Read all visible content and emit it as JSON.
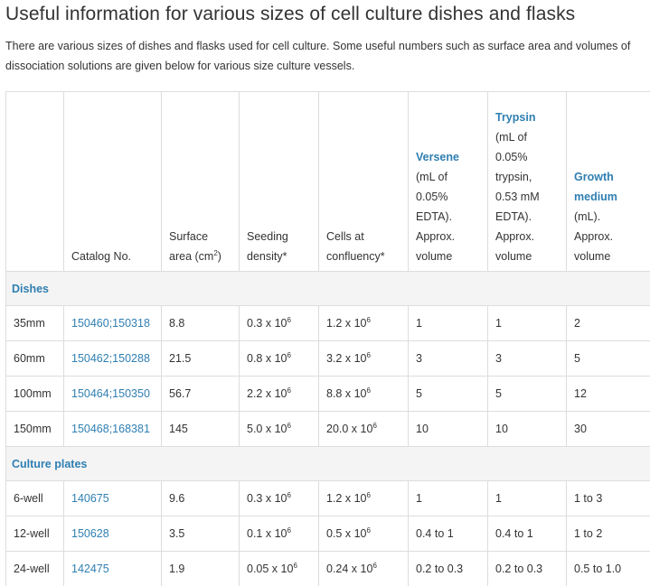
{
  "title": "Useful information for various sizes of cell culture dishes and flasks",
  "intro": "There are various sizes of dishes and flasks used for cell culture. Some useful numbers such as surface area and volumes of dissociation solutions are given below for various size culture vessels.",
  "table": {
    "headers": {
      "catalog": "Catalog No.",
      "surface_a": "Surface",
      "surface_b": "area (cm",
      "surface_sup": "2",
      "surface_c": ")",
      "seeding_a": "Seeding",
      "seeding_b": "density*",
      "cells_a": "Cells at",
      "cells_b": "confluency*",
      "versene_link": "Versene",
      "versene_rest": [
        "(mL of",
        "0.05%",
        "EDTA).",
        "Approx.",
        "volume"
      ],
      "trypsin_link": "Trypsin",
      "trypsin_rest": [
        "(mL of",
        "0.05%",
        "trypsin,",
        "0.53 mM",
        "EDTA).",
        "Approx.",
        "volume"
      ],
      "growth_link_a": "Growth",
      "growth_link_b": "medium",
      "growth_rest": [
        "(mL).",
        "Approx.",
        "volume"
      ]
    },
    "sections": [
      {
        "label": "Dishes",
        "rows": [
          {
            "size": "35mm",
            "catalog": "150460;150318",
            "surface": "8.8",
            "seeding": "0.3 x 10",
            "seeding_exp": "6",
            "cells": "1.2 x 10",
            "cells_exp": "6",
            "versene": "1",
            "trypsin": "1",
            "growth": "2"
          },
          {
            "size": "60mm",
            "catalog": "150462;150288",
            "surface": "21.5",
            "seeding": "0.8 x 10",
            "seeding_exp": "6",
            "cells": "3.2 x 10",
            "cells_exp": "6",
            "versene": "3",
            "trypsin": "3",
            "growth": "5"
          },
          {
            "size": "100mm",
            "catalog": "150464;150350",
            "surface": "56.7",
            "seeding": "2.2 x 10",
            "seeding_exp": "6",
            "cells": "8.8 x 10",
            "cells_exp": "6",
            "versene": "5",
            "trypsin": "5",
            "growth": "12"
          },
          {
            "size": "150mm",
            "catalog": "150468;168381",
            "surface": "145",
            "seeding": "5.0 x 10",
            "seeding_exp": "6",
            "cells": "20.0 x 10",
            "cells_exp": "6",
            "versene": "10",
            "trypsin": "10",
            "growth": "30"
          }
        ]
      },
      {
        "label": "Culture plates",
        "rows": [
          {
            "size": "6-well",
            "catalog": "140675",
            "surface": "9.6",
            "seeding": "0.3 x 10",
            "seeding_exp": "6",
            "cells": "1.2 x 10",
            "cells_exp": "6",
            "versene": "1",
            "trypsin": "1",
            "growth": "1 to 3"
          },
          {
            "size": "12-well",
            "catalog": "150628",
            "surface": "3.5",
            "seeding": "0.1 x 10",
            "seeding_exp": "6",
            "cells": "0.5 x 10",
            "cells_exp": "6",
            "versene": "0.4 to 1",
            "trypsin": "0.4 to 1",
            "growth": "1 to 2"
          },
          {
            "size": "24-well",
            "catalog": "142475",
            "surface": "1.9",
            "seeding": "0.05 x 10",
            "seeding_exp": "6",
            "cells": "0.24 x 10",
            "cells_exp": "6",
            "versene": "0.2 to 0.3",
            "trypsin": "0.2 to 0.3",
            "growth": "0.5 to 1.0"
          }
        ]
      }
    ]
  }
}
